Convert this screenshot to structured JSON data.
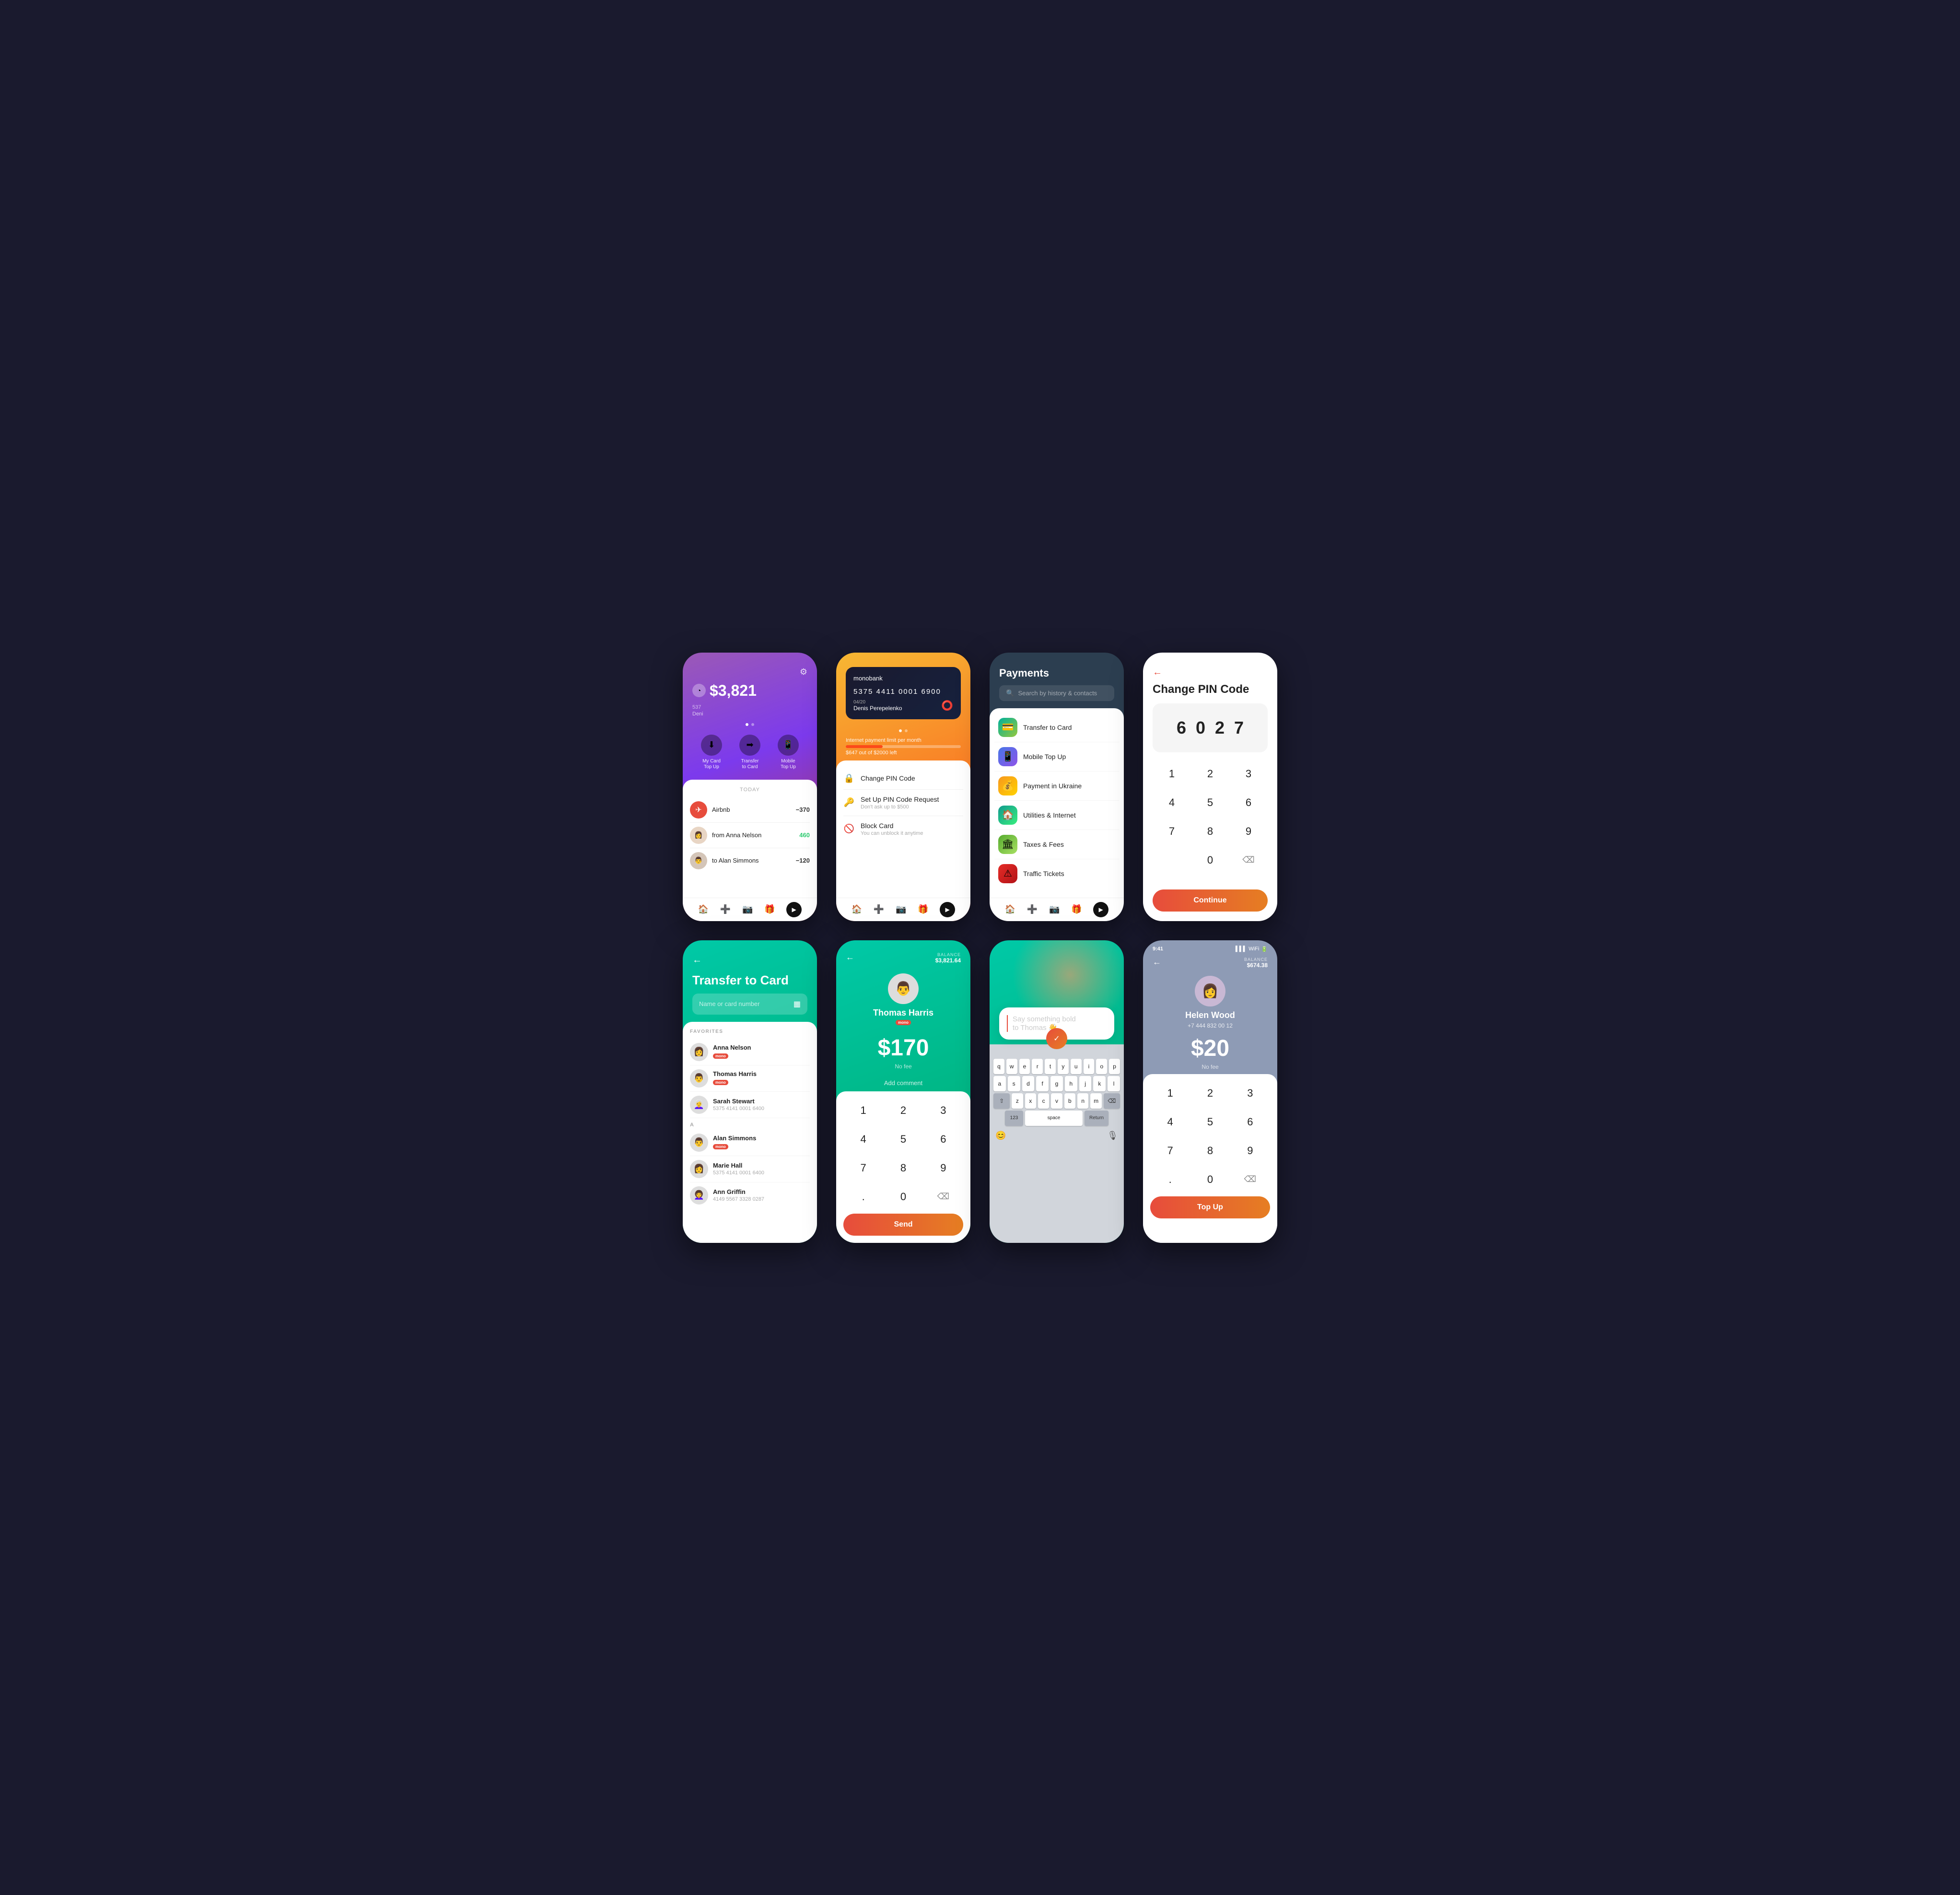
{
  "phones": {
    "phone1": {
      "balance": "$3,821",
      "card_last4": "537",
      "card_name": "Deni",
      "settings_icon": "⚙",
      "actions": [
        {
          "icon": "⬇",
          "label": "My Card\nTop Up"
        },
        {
          "icon": "➡",
          "label": "Transfer\nto Card"
        },
        {
          "icon": "📱",
          "label": "Mobile\nTop Up"
        }
      ],
      "section_label": "TODAY",
      "transactions": [
        {
          "name": "Airbnb",
          "amount": "−370",
          "positive": false
        },
        {
          "name": "from Anna Nelson",
          "amount": "460",
          "positive": true
        },
        {
          "name": "to Alan Simmons",
          "amount": "−120",
          "positive": false
        }
      ]
    },
    "phone2": {
      "bank_name": "monobank",
      "card_number": "5375 4411 0001 6900",
      "card_expiry": "04/20",
      "card_holder": "Denis Perepelenko",
      "limit_label": "Internet payment limit per month",
      "limit_sub": "$647 out of $2000 left",
      "menu_items": [
        {
          "icon": "🔒",
          "title": "Change PIN Code",
          "subtitle": ""
        },
        {
          "icon": "🔑",
          "title": "Set Up PIN Code Request",
          "subtitle": "Don't ask up to $500"
        },
        {
          "icon": "🚫",
          "title": "Block Card",
          "subtitle": "You can unblock it anytime"
        }
      ]
    },
    "phone3": {
      "title": "Payments",
      "search_placeholder": "Search by history & contacts",
      "payment_items": [
        {
          "label": "Transfer to Card",
          "icon_class": "pay-icon-teal",
          "icon": "💳"
        },
        {
          "label": "Mobile Top Up",
          "icon_class": "pay-icon-blue",
          "icon": "📱"
        },
        {
          "label": "Payment in Ukraine",
          "icon_class": "pay-icon-orange",
          "icon": "💰"
        },
        {
          "label": "Utilities & Internet",
          "icon_class": "pay-icon-green",
          "icon": "🏠"
        },
        {
          "label": "Taxes & Fees",
          "icon_class": "pay-icon-lime",
          "icon": "🏛"
        },
        {
          "label": "Traffic Tickets",
          "icon_class": "pay-icon-red",
          "icon": "⚠"
        }
      ]
    },
    "phone4": {
      "title": "Change PIN Code",
      "pin_digits": [
        "6",
        "0",
        "2",
        "7"
      ],
      "keys": [
        [
          "1",
          "2",
          "3"
        ],
        [
          "4",
          "5",
          "6"
        ],
        [
          "7",
          "8",
          "9"
        ],
        [
          "",
          "0",
          "⌫"
        ]
      ],
      "continue_label": "Continue"
    },
    "phone5": {
      "title": "Transfer to Card",
      "input_placeholder": "Name or card number",
      "favorites_label": "FAVORITES",
      "favorites": [
        {
          "name": "Anna Nelson",
          "badge": "mono",
          "sub": ""
        },
        {
          "name": "Thomas Harris",
          "badge": "mono",
          "sub": ""
        },
        {
          "name": "Sarah Stewart",
          "badge": "",
          "sub": "5375 4141 0001 6400"
        }
      ],
      "section_a": "A",
      "contacts_a": [
        {
          "name": "Alan Simmons",
          "badge": "mono",
          "sub": ""
        },
        {
          "name": "Marie Hall",
          "badge": "",
          "sub": "5375 4141 0001 6400"
        },
        {
          "name": "Ann Griffin",
          "badge": "",
          "sub": "4149 5567 3328 0287"
        }
      ]
    },
    "phone6": {
      "back_icon": "←",
      "balance_label": "BALANCE",
      "balance_amount": "$3,821.64",
      "contact_name": "Thomas Harris",
      "contact_badge": "mono",
      "amount": "$170",
      "no_fee": "No fee",
      "add_comment": "Add comment",
      "keys": [
        [
          "1",
          "2",
          "3"
        ],
        [
          "4",
          "5",
          "6"
        ],
        [
          "7",
          "8",
          "9"
        ],
        [
          ".",
          "0",
          "⌫"
        ]
      ],
      "send_label": "Send"
    },
    "phone7": {
      "message_placeholder": "Say something bold\nto Thomas 👋",
      "keyboard_rows": [
        [
          "q",
          "w",
          "e",
          "r",
          "t",
          "y",
          "u",
          "i",
          "o",
          "p"
        ],
        [
          "a",
          "s",
          "d",
          "f",
          "g",
          "h",
          "j",
          "k",
          "l"
        ],
        [
          "z",
          "x",
          "c",
          "v",
          "b",
          "n",
          "m"
        ],
        [
          "123",
          "space",
          "Return"
        ]
      ]
    },
    "phone8": {
      "status_time": "9:41",
      "back_icon": "←",
      "balance_label": "BALANCE",
      "balance_amount": "$674.38",
      "contact_name": "Helen Wood",
      "contact_phone": "+7 444 832 00 12",
      "amount": "$20",
      "no_fee": "No fee",
      "keys": [
        [
          "1",
          "2",
          "3"
        ],
        [
          "4",
          "5",
          "6"
        ],
        [
          "7",
          "8",
          "9"
        ],
        [
          ".",
          "0",
          "⌫"
        ]
      ],
      "topup_label": "Top Up"
    }
  }
}
